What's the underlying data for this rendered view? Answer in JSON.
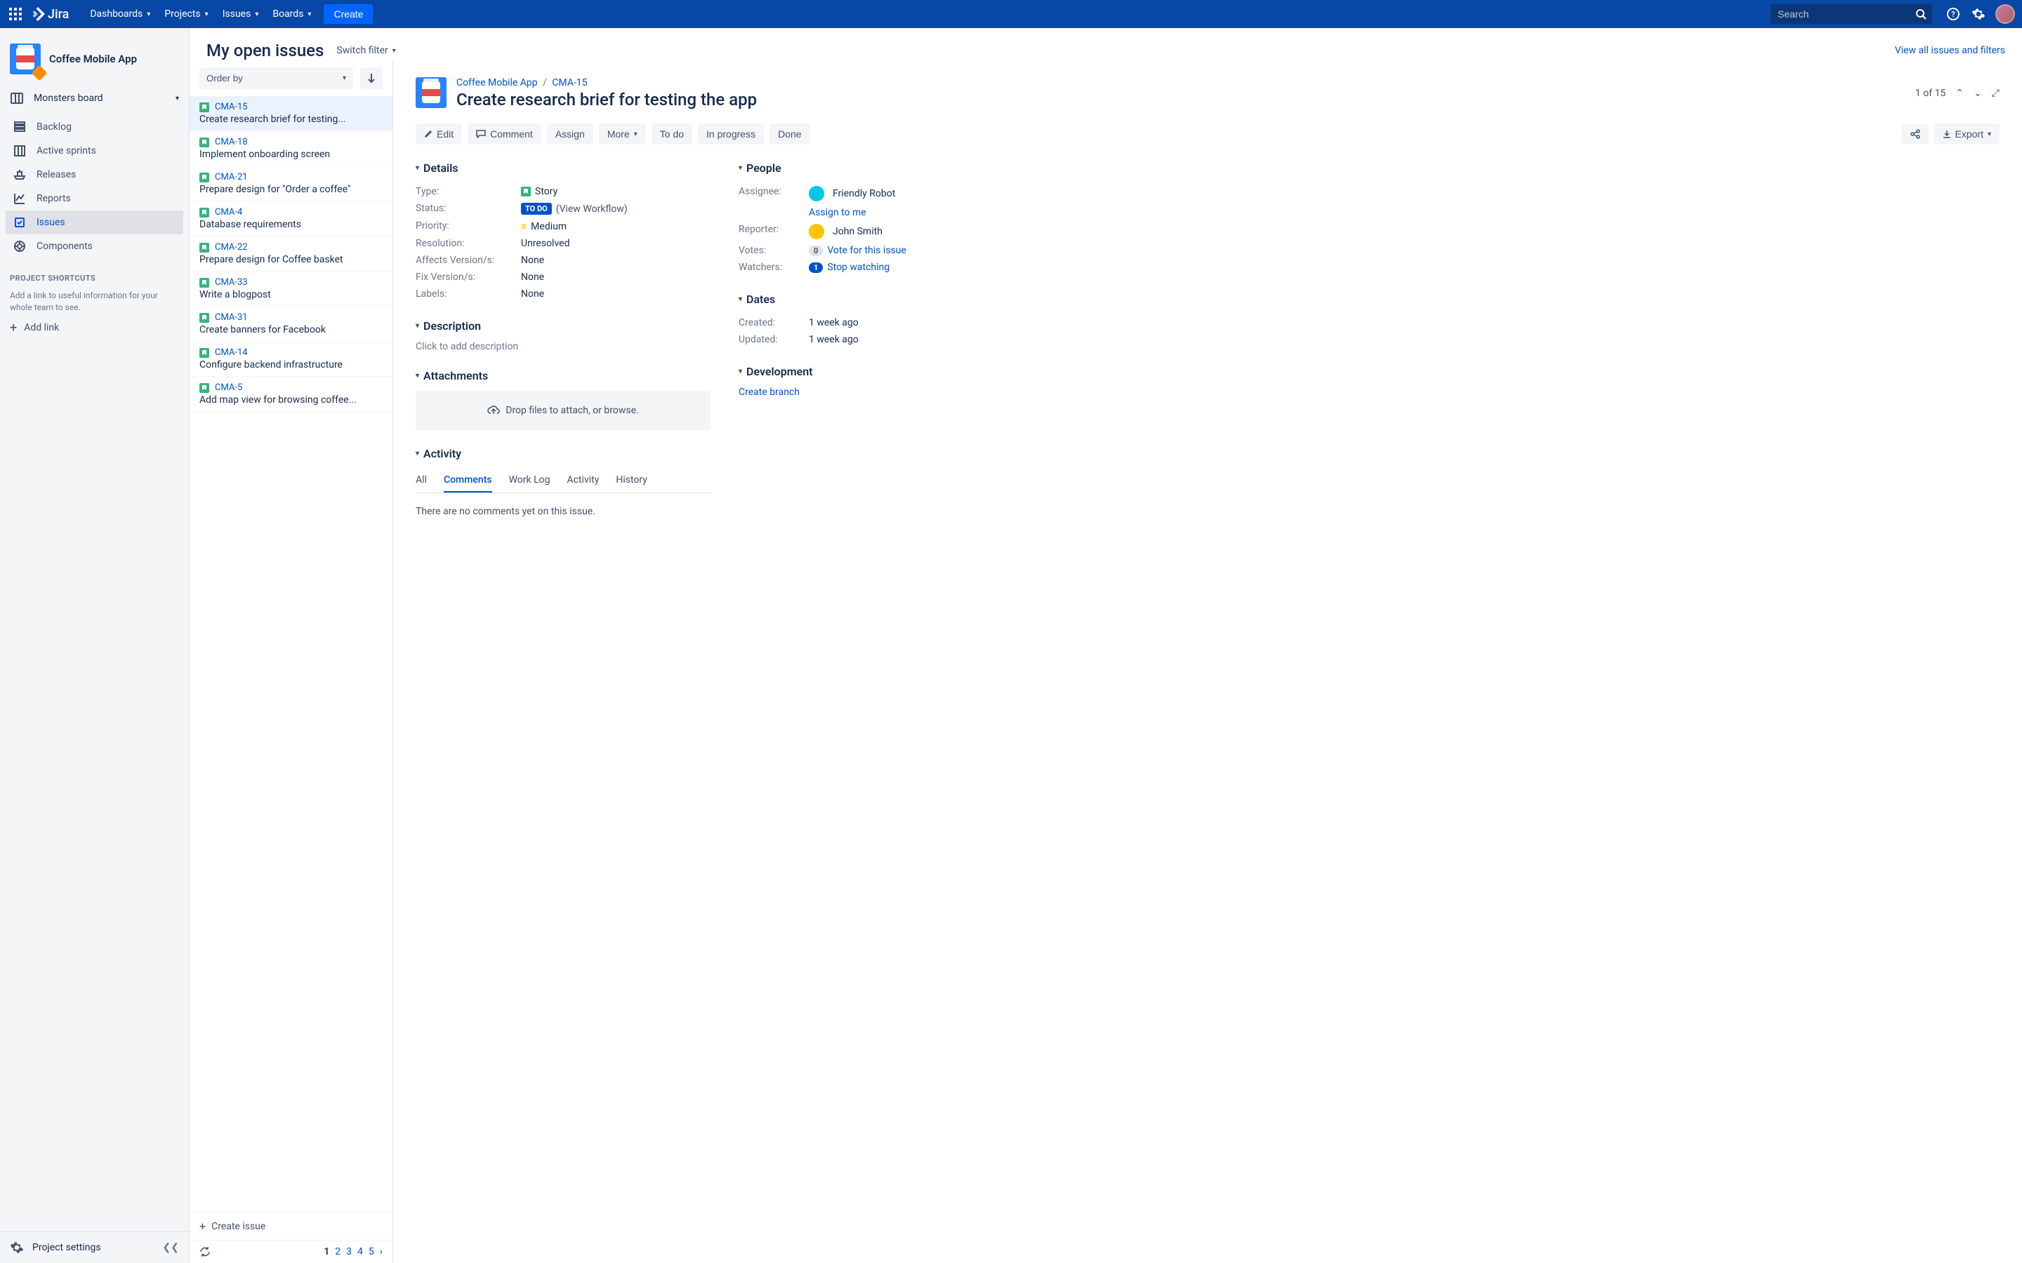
{
  "topbar": {
    "logo": "Jira",
    "nav": [
      "Dashboards",
      "Projects",
      "Issues",
      "Boards"
    ],
    "create": "Create",
    "search_placeholder": "Search"
  },
  "sidebar": {
    "project_name": "Coffee Mobile App",
    "board_selector": "Monsters board",
    "nav": [
      {
        "label": "Backlog",
        "icon": "backlog"
      },
      {
        "label": "Active sprints",
        "icon": "board"
      },
      {
        "label": "Releases",
        "icon": "ship"
      },
      {
        "label": "Reports",
        "icon": "chart"
      },
      {
        "label": "Issues",
        "icon": "issues",
        "active": true
      },
      {
        "label": "Components",
        "icon": "component"
      }
    ],
    "shortcuts_heading": "PROJECT SHORTCUTS",
    "shortcuts_desc": "Add a link to useful information for your whole team to see.",
    "add_link": "Add link",
    "settings": "Project settings"
  },
  "list_header": {
    "title": "My open issues",
    "switch_filter": "Switch filter",
    "view_all": "View all issues and filters"
  },
  "list": {
    "order_by": "Order by",
    "items": [
      {
        "key": "CMA-15",
        "summary": "Create research brief for testing...",
        "selected": true
      },
      {
        "key": "CMA-18",
        "summary": "Implement onboarding screen"
      },
      {
        "key": "CMA-21",
        "summary": "Prepare design for \"Order a coffee\""
      },
      {
        "key": "CMA-4",
        "summary": "Database requirements"
      },
      {
        "key": "CMA-22",
        "summary": "Prepare design for Coffee basket"
      },
      {
        "key": "CMA-33",
        "summary": "Write a blogpost"
      },
      {
        "key": "CMA-31",
        "summary": "Create banners for Facebook"
      },
      {
        "key": "CMA-14",
        "summary": "Configure backend infrastructure"
      },
      {
        "key": "CMA-5",
        "summary": "Add map view for browsing coffee..."
      }
    ],
    "create_issue": "Create issue",
    "pages": [
      "1",
      "2",
      "3",
      "4",
      "5"
    ]
  },
  "detail": {
    "breadcrumb_project": "Coffee Mobile App",
    "breadcrumb_key": "CMA-15",
    "title": "Create research brief for testing the app",
    "position": "1 of 15",
    "actions": {
      "edit": "Edit",
      "comment": "Comment",
      "assign": "Assign",
      "more": "More",
      "todo": "To do",
      "inprogress": "In progress",
      "done": "Done",
      "export": "Export"
    },
    "sections": {
      "details": "Details",
      "people": "People",
      "dates": "Dates",
      "development": "Development",
      "description": "Description",
      "attachments": "Attachments",
      "activity": "Activity"
    },
    "details": {
      "type_label": "Type:",
      "type_value": "Story",
      "status_label": "Status:",
      "status_value": "TO DO",
      "status_link": "(View Workflow)",
      "priority_label": "Priority:",
      "priority_value": "Medium",
      "resolution_label": "Resolution:",
      "resolution_value": "Unresolved",
      "affects_label": "Affects Version/s:",
      "affects_value": "None",
      "fix_label": "Fix Version/s:",
      "fix_value": "None",
      "labels_label": "Labels:",
      "labels_value": "None"
    },
    "people": {
      "assignee_label": "Assignee:",
      "assignee_value": "Friendly Robot",
      "assign_to_me": "Assign to me",
      "reporter_label": "Reporter:",
      "reporter_value": "John Smith",
      "votes_label": "Votes:",
      "votes_count": "0",
      "votes_link": "Vote for this issue",
      "watchers_label": "Watchers:",
      "watchers_count": "1",
      "watchers_link": "Stop watching"
    },
    "dates": {
      "created_label": "Created:",
      "created_value": "1 week ago",
      "updated_label": "Updated:",
      "updated_value": "1 week ago"
    },
    "development": {
      "create_branch": "Create branch"
    },
    "description_placeholder": "Click to add description",
    "attachments_drop": "Drop files to attach, or browse.",
    "activity": {
      "tabs": [
        "All",
        "Comments",
        "Work Log",
        "Activity",
        "History"
      ],
      "active_tab": 1,
      "no_comments": "There are no comments yet on this issue."
    }
  }
}
